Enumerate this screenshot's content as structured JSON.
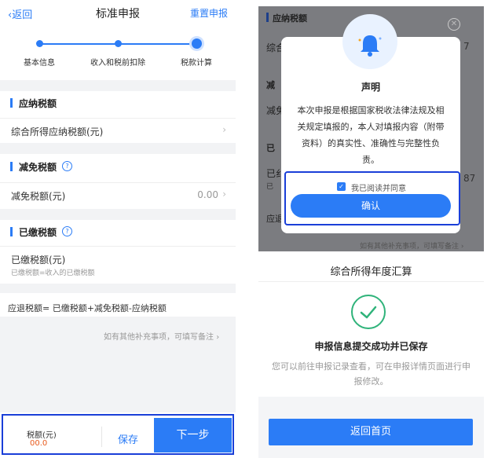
{
  "left": {
    "nav": {
      "back": "返回",
      "title": "标准申报",
      "reset": "重置申报"
    },
    "steps": [
      "基本信息",
      "收入和税前扣除",
      "税款计算"
    ],
    "sections": {
      "payable": {
        "title": "应纳税额",
        "row_label": "综合所得应纳税额(元)",
        "row_value": ""
      },
      "reduction": {
        "title": "减免税额",
        "row_label": "减免税额(元)",
        "row_value": "0.00"
      },
      "paid": {
        "title": "已缴税额",
        "row_label": "已缴税额(元)",
        "row_sub": "已缴税额=收入的已缴税额"
      }
    },
    "formula": "应退税额= 已缴税额+减免税额-应纳税额",
    "note": "如有其他补充事项，可填写备注",
    "footer": {
      "label": "税额(元)",
      "value": "00.0",
      "save": "保存",
      "next": "下一步"
    }
  },
  "right": {
    "background": {
      "section": "应纳税额",
      "row1": "综合",
      "row1_tail": "7",
      "row2": "减",
      "row3": "减免",
      "row4": "已",
      "row5": "已纟",
      "row5_sub": "已",
      "row5_val": "87",
      "row6": "应退"
    },
    "modal": {
      "title": "声明",
      "body": "本次申报是根据国家税收法律法规及相关规定填报的，本人对填报内容（附带资料）的真实性、准确性与完整性负责。",
      "checkbox_label": "我已阅读并同意",
      "confirm": "确认"
    },
    "note": "如有其他补充事项，可填写备注",
    "result": {
      "title": "综合所得年度汇算",
      "success_title": "申报信息提交成功并已保存",
      "success_desc": "您可以前往申报记录查看，可在申报详情页面进行申报修改。",
      "home_button": "返回首页"
    }
  },
  "colors": {
    "accent": "#2b7cf6",
    "success": "#2fb37a",
    "highlight": "#1a3fd8",
    "overlay": "#7b7c80"
  }
}
